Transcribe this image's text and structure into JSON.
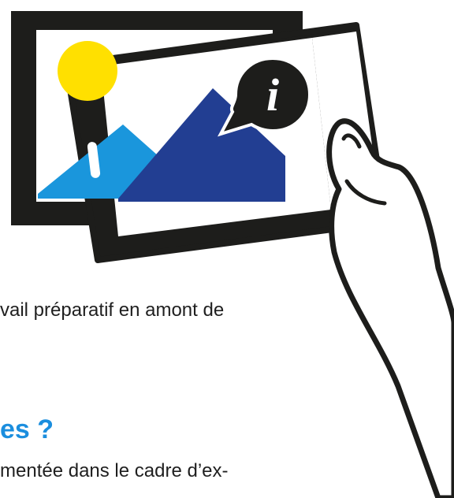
{
  "text": {
    "line1": "vail préparatif en amont de",
    "heading": "es ?",
    "line2": "mentée dans le cadre d’ex-"
  },
  "illustration": {
    "info_badge": "i",
    "colors": {
      "frame": "#1d1d1b",
      "sun": "#ffe000",
      "mountain_light": "#1a96dc",
      "mountain_dark": "#223e92",
      "heading_blue": "#1b8ede"
    }
  }
}
